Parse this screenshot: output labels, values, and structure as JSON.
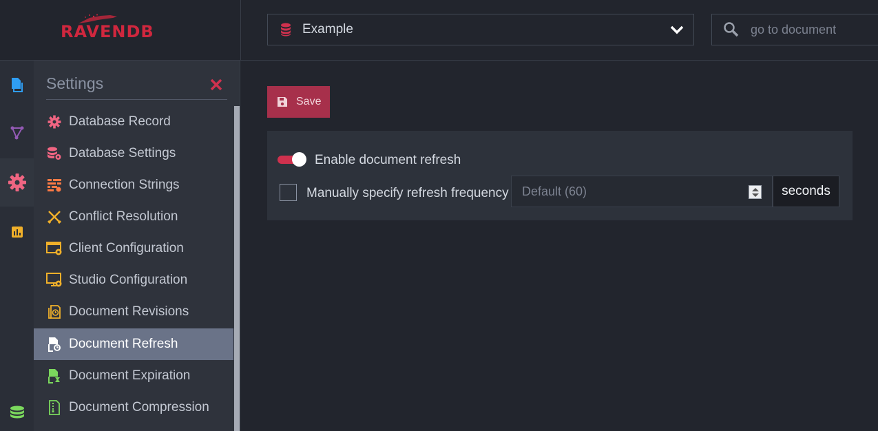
{
  "header": {
    "logo_text": "RAVENDB",
    "database": {
      "selected": "Example"
    },
    "search": {
      "placeholder": "go to document"
    }
  },
  "rail": {
    "items": [
      {
        "icon": "documents-icon",
        "color": "#2f9ef4"
      },
      {
        "icon": "indexes-icon",
        "color": "#945ab5"
      },
      {
        "icon": "settings-icon",
        "color": "#f06582",
        "active": true
      },
      {
        "icon": "stats-icon",
        "color": "#f0b02a"
      },
      {
        "icon": "databases-icon",
        "color": "#7bd85d"
      }
    ]
  },
  "settings_menu": {
    "title": "Settings",
    "items": [
      {
        "label": "Database Record",
        "icon": "gear-icon",
        "color": "#f06582"
      },
      {
        "label": "Database Settings",
        "icon": "database-settings-icon",
        "color": "#f06582"
      },
      {
        "label": "Connection Strings",
        "icon": "connection-strings-icon",
        "color": "#ff7a45"
      },
      {
        "label": "Conflict Resolution",
        "icon": "conflict-icon",
        "color": "#f0b02a"
      },
      {
        "label": "Client Configuration",
        "icon": "client-config-icon",
        "color": "#f0b02a"
      },
      {
        "label": "Studio Configuration",
        "icon": "studio-config-icon",
        "color": "#f0b02a"
      },
      {
        "label": "Document Revisions",
        "icon": "revisions-icon",
        "color": "#f0b02a"
      },
      {
        "label": "Document Refresh",
        "icon": "refresh-icon",
        "color": "#ffffff",
        "active": true
      },
      {
        "label": "Document Expiration",
        "icon": "expiration-icon",
        "color": "#7bd85d"
      },
      {
        "label": "Document Compression",
        "icon": "compression-icon",
        "color": "#7bd85d"
      }
    ]
  },
  "content": {
    "save_label": "Save",
    "enable_refresh": {
      "label": "Enable document refresh",
      "enabled": true
    },
    "manual_frequency": {
      "label": "Manually specify refresh frequency",
      "checked": false,
      "placeholder": "Default (60)",
      "unit": "seconds"
    }
  },
  "colors": {
    "accent": "#d0314e",
    "save_button": "#a7304b",
    "active_menu": "#6a7388",
    "background": "#22252d"
  }
}
